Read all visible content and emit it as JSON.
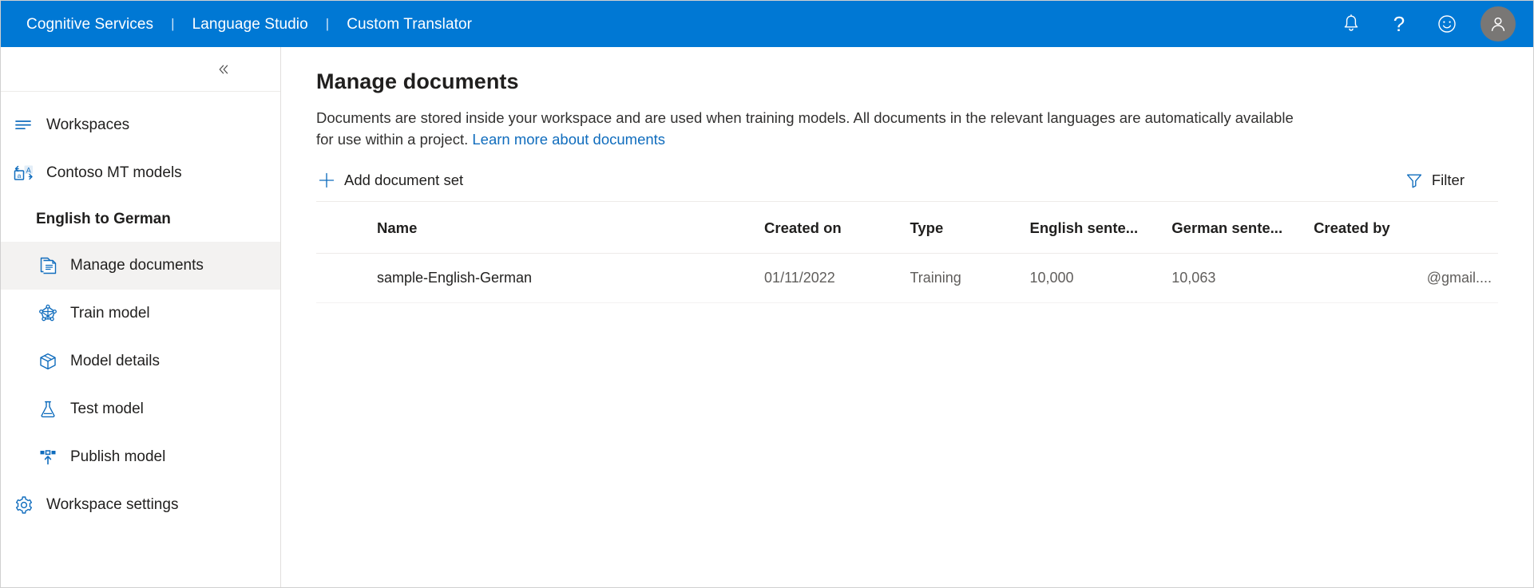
{
  "topbar": {
    "brand_items": [
      {
        "label": "Cognitive Services",
        "name": "brand-cognitive-services"
      },
      {
        "label": "Language Studio",
        "name": "brand-language-studio"
      },
      {
        "label": "Custom Translator",
        "name": "brand-custom-translator"
      }
    ],
    "separator": "|",
    "icons": [
      {
        "name": "notification-bell-icon",
        "label": "Notifications"
      },
      {
        "name": "help-question-icon",
        "label": "Help"
      },
      {
        "name": "feedback-smiley-icon",
        "label": "Feedback"
      },
      {
        "name": "account-avatar",
        "label": "Account"
      }
    ],
    "help_glyph": "?",
    "accent_color": "#0078d4",
    "avatar_color": "#797775"
  },
  "sidebar": {
    "collapse_icon": "chevron-double-left-icon",
    "items": [
      {
        "label": "Workspaces",
        "icon": "list-lines-icon",
        "indented": false,
        "active": false
      },
      {
        "label": "Contoso MT models",
        "icon": "translate-icon",
        "indented": false,
        "active": false
      }
    ],
    "group_title": "English to German",
    "project_items": [
      {
        "label": "Manage documents",
        "icon": "document-icon",
        "indented": true,
        "active": true
      },
      {
        "label": "Train model",
        "icon": "neural-network-icon",
        "indented": true,
        "active": false
      },
      {
        "label": "Model details",
        "icon": "cube-box-icon",
        "indented": true,
        "active": false
      },
      {
        "label": "Test model",
        "icon": "flask-icon",
        "indented": true,
        "active": false
      },
      {
        "label": "Publish model",
        "icon": "publish-upload-icon",
        "indented": true,
        "active": false
      }
    ],
    "settings_item": {
      "label": "Workspace settings",
      "icon": "gear-icon",
      "indented": false,
      "active": false
    },
    "active_background": "#f3f2f1"
  },
  "main": {
    "title": "Manage documents",
    "description_part1": "Documents are stored inside your workspace and are used when training models. All documents in the relevant languages are automatically available for use within a project. ",
    "description_link": "Learn more about documents",
    "link_color": "#0f6cbd",
    "commands": {
      "add_label": "Add document set",
      "add_icon": "plus-icon",
      "filter_label": "Filter",
      "filter_icon": "funnel-filter-icon"
    },
    "table": {
      "columns": [
        "Name",
        "Created on",
        "Type",
        "English sente...",
        "German sente...",
        "Created by"
      ],
      "rows": [
        {
          "name": "sample-English-German",
          "created_on": "01/11/2022",
          "type": "Training",
          "english_sentences": "10,000",
          "german_sentences": "10,063",
          "created_by": "@gmail...."
        }
      ]
    }
  }
}
